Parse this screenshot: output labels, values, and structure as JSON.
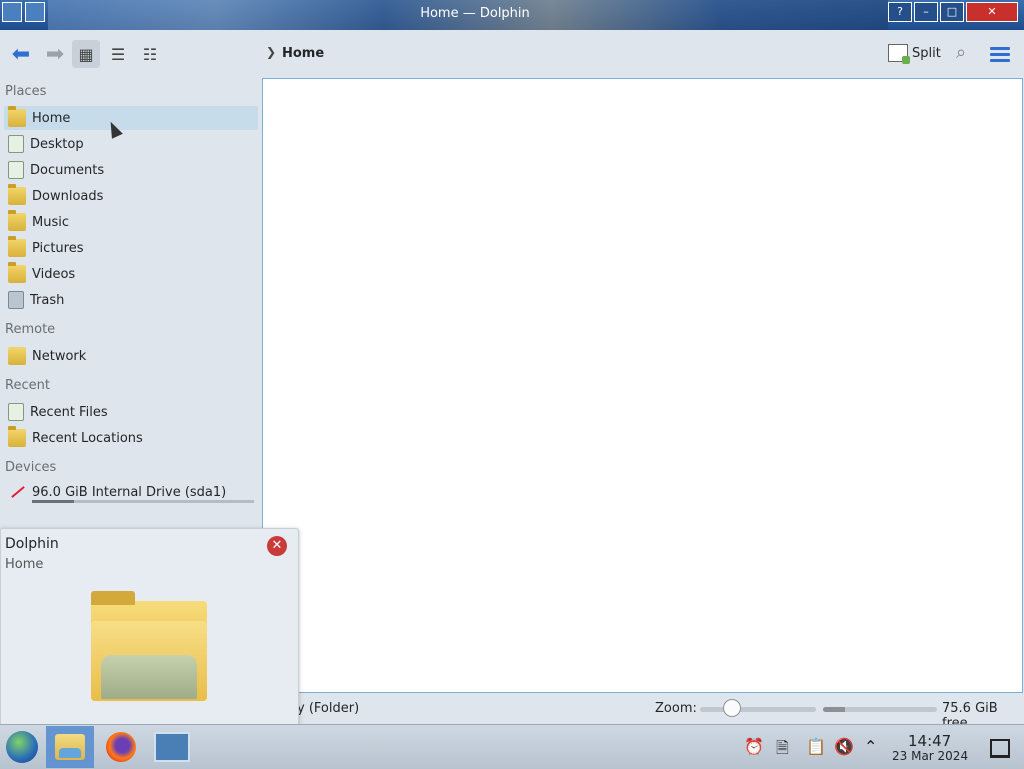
{
  "window": {
    "title": "Home — Dolphin",
    "help_label": "?",
    "min_label": "–",
    "max_label": "□",
    "close_label": "✕"
  },
  "toolbar": {
    "back_icon": "arrow-left-icon",
    "forward_icon": "arrow-right-icon",
    "breadcrumb": "Home",
    "split_label": "Split"
  },
  "sidebar": {
    "places_title": "Places",
    "places": [
      {
        "label": "Home",
        "icon": "home-folder-icon",
        "selected": true
      },
      {
        "label": "Desktop",
        "icon": "desktop-icon"
      },
      {
        "label": "Documents",
        "icon": "documents-icon"
      },
      {
        "label": "Downloads",
        "icon": "downloads-icon"
      },
      {
        "label": "Music",
        "icon": "music-icon"
      },
      {
        "label": "Pictures",
        "icon": "pictures-icon"
      },
      {
        "label": "Videos",
        "icon": "videos-icon"
      },
      {
        "label": "Trash",
        "icon": "trash-icon"
      }
    ],
    "remote_title": "Remote",
    "remote": [
      {
        "label": "Network",
        "icon": "network-icon"
      }
    ],
    "recent_title": "Recent",
    "recent": [
      {
        "label": "Recent Files",
        "icon": "recent-files-icon"
      },
      {
        "label": "Recent Locations",
        "icon": "recent-locations-icon"
      }
    ],
    "devices_title": "Devices",
    "devices": [
      {
        "label": "96.0 GiB Internal Drive (sda1)",
        "icon": "drive-icon",
        "usage_fraction": 0.19
      }
    ]
  },
  "status": {
    "left_text": "dnSpy (Folder)",
    "zoom_label": "Zoom:",
    "zoom_fraction": 0.27,
    "space_used_fraction": 0.19,
    "free_text": "75.6 GiB free"
  },
  "popup": {
    "title": "Dolphin",
    "subtitle": "Home",
    "close_icon": "close-icon"
  },
  "taskbar": {
    "time": "14:47",
    "date": "23 Mar 2024"
  }
}
